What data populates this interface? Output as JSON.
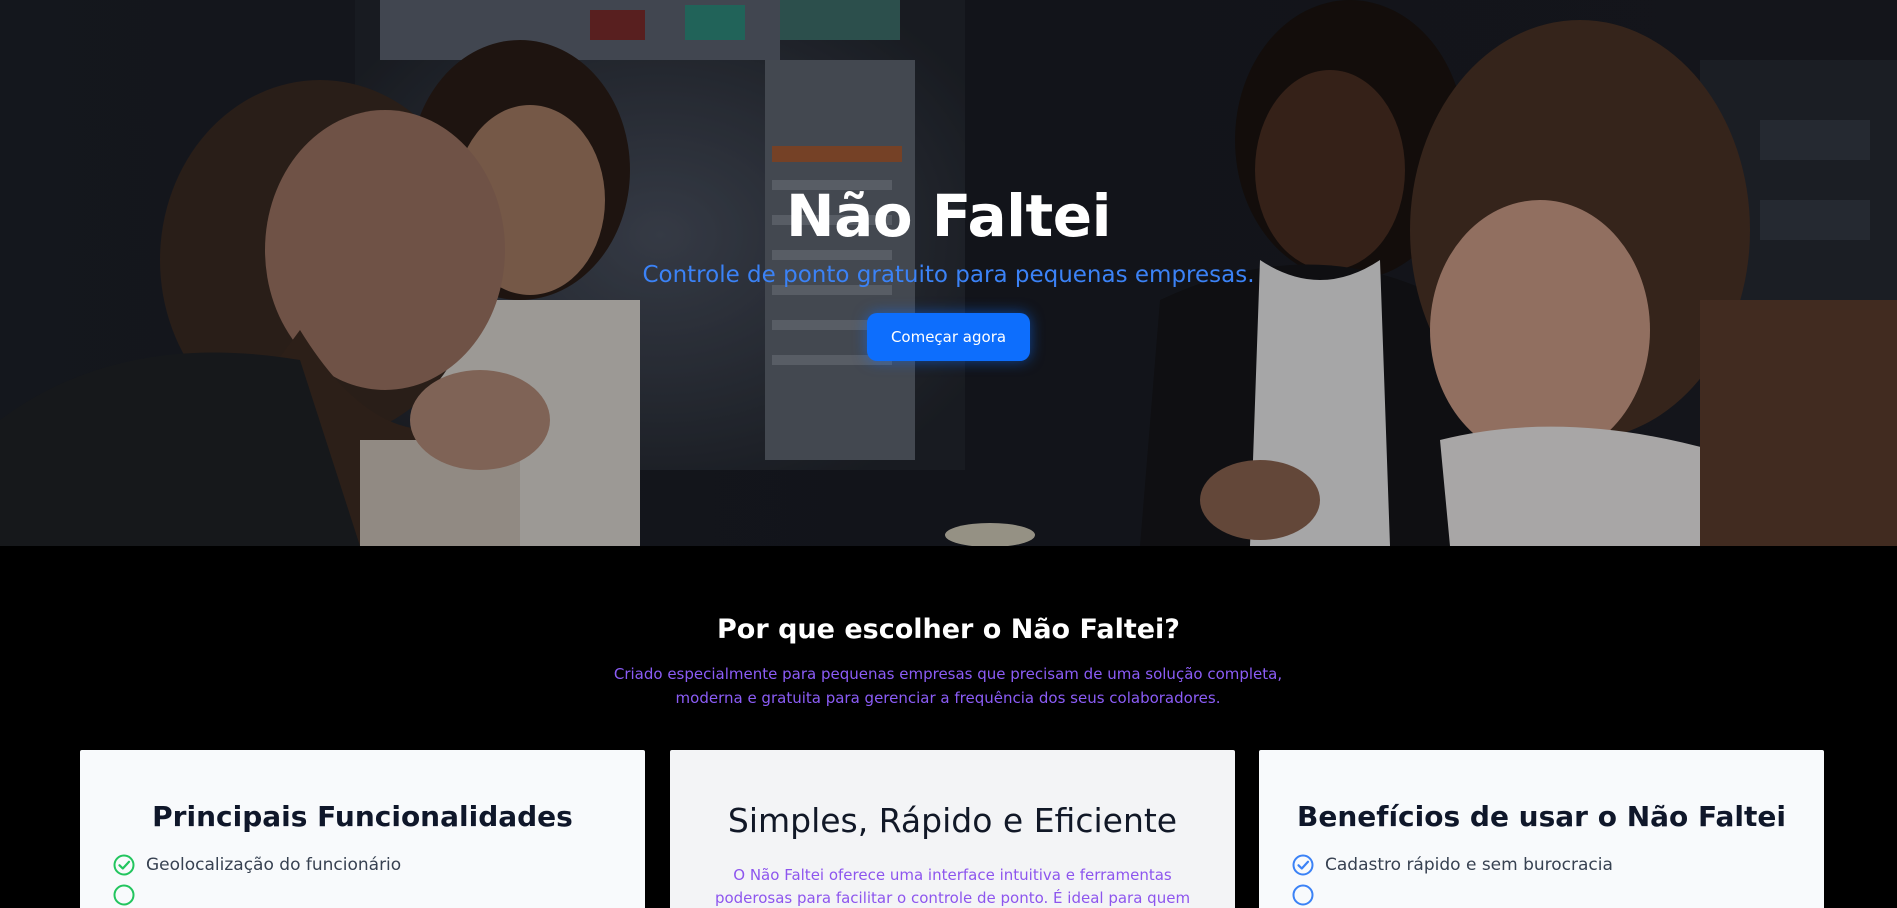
{
  "hero": {
    "title": "Não Faltei",
    "subtitle": "Controle de ponto gratuito para pequenas empresas.",
    "cta_label": "Começar agora",
    "image": "team-meeting-photo",
    "colors": {
      "subtitle": "#3b82f6",
      "button": "#0d6efd"
    }
  },
  "why": {
    "title": "Por que escolher o Não Faltei?",
    "description": "Criado especialmente para pequenas empresas que precisam de uma solução completa, moderna e gratuita para gerenciar a frequência dos seus colaboradores.",
    "description_color": "#8b5cf6"
  },
  "cards": [
    {
      "title": "Principais Funcionalidades",
      "items": [
        {
          "icon": "check-circle-icon",
          "text": "Geolocalização do funcionário",
          "icon_color": "#22c55e"
        }
      ]
    },
    {
      "title": "Simples, Rápido e Eficiente",
      "text": "O Não Faltei oferece uma interface intuitiva e ferramentas poderosas para facilitar o controle de ponto. É ideal para quem precisa de uma"
    },
    {
      "title": "Benefícios de usar o Não Faltei",
      "items": [
        {
          "icon": "check-circle-icon",
          "text": "Cadastro rápido e sem burocracia",
          "icon_color": "#3b82f6"
        }
      ]
    }
  ]
}
